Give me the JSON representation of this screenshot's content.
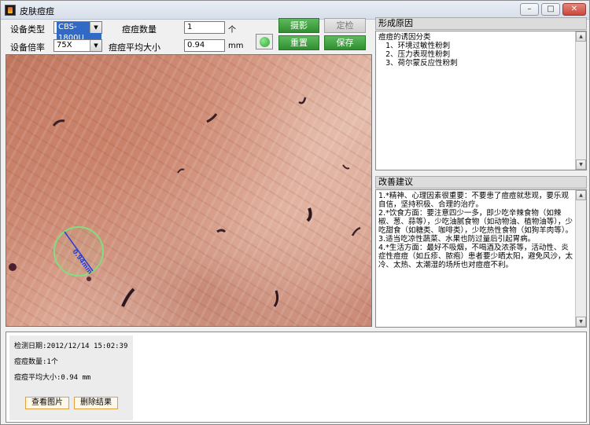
{
  "window": {
    "title": "皮肤痘痘",
    "minimize": "–",
    "maximize": "□",
    "close": "✕"
  },
  "controls": {
    "device_type_label": "设备类型",
    "device_type_value": "CBS-1800U",
    "device_zoom_label": "设备倍率",
    "device_zoom_value": "75X",
    "acne_count_label": "痘痘数量",
    "acne_count_value": "1",
    "acne_count_unit": "个",
    "acne_size_label": "痘痘平均大小",
    "acne_size_value": "0.94",
    "acne_size_unit": "mm"
  },
  "buttons": {
    "capture": "摄影",
    "locate": "定检",
    "reset": "重置",
    "save": "保存"
  },
  "status": {
    "color": "#2fa52f"
  },
  "image": {
    "measure_label": "0.94mm"
  },
  "cause_panel": {
    "title": "形成原因",
    "lines": [
      "痘痘的诱因分类",
      "   1、环境过敏性粉刺",
      "   2、压力表现性粉刺",
      "   3、荷尔蒙反应性粉刺"
    ]
  },
  "advice_panel": {
    "title": "改善建议",
    "lines": [
      "1.*精神、心理因素很重要：不要患了痘痘就悲观，要乐观自信，坚持积极、合理的治疗。",
      "2.*饮食方面：要注意四少一多，即少吃辛辣食物（如辣椒、葱、蒜等），少吃油腻食物（如动物油、植物油等），少吃甜食（如糖类、咖啡类），少吃热性食物（如狗羊肉等）。",
      "3.适当吃凉性蔬菜、水果也防过量后引起胃病。",
      "4.*生活方面：最好不吸烟，不喝酒及浓茶等，活动性、炎症性痘痘（如丘疹、脓疱）患者要少晒太阳，避免风沙，太冷、太热、太潮湿的场所也对痘痘不利。"
    ]
  },
  "results": {
    "date_line": "检测日期:2012/12/14 15:02:39",
    "count_line": "痘痘数量:1个",
    "size_line": "痘痘平均大小:0.94 mm",
    "view_button": "查看图片",
    "delete_button": "删除结果"
  }
}
